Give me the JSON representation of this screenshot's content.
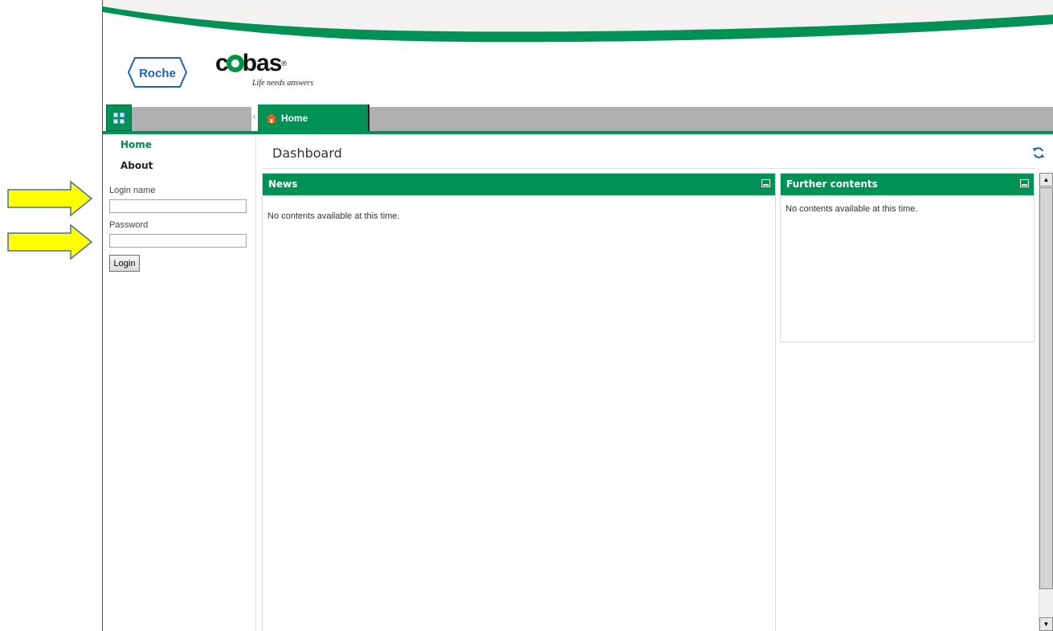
{
  "brand": {
    "roche_logo_text": "Roche",
    "cobas_logo_text": "cobas",
    "registered_mark": "®",
    "tagline": "Life needs answers"
  },
  "tabs": [
    {
      "label": "Home",
      "active": true
    }
  ],
  "sidebar": {
    "nav": [
      {
        "label": "Home"
      },
      {
        "label": "About"
      }
    ],
    "login": {
      "login_name_label": "Login name",
      "login_name_value": "",
      "password_label": "Password",
      "password_value": "",
      "login_button": "Login"
    }
  },
  "dashboard": {
    "title": "Dashboard",
    "panels": [
      {
        "title": "News",
        "body": "No contents available at this time."
      },
      {
        "title": "Further contents",
        "body": "No contents available at this time."
      }
    ]
  },
  "colors": {
    "brand_green": "#009155",
    "tab_gray": "#b0afb1",
    "annotation_arrow": "#ffff00"
  },
  "icons": [
    "menu-grid-icon",
    "home-icon",
    "refresh-icon",
    "minimize-icon",
    "scroll-up-icon",
    "scroll-down-icon",
    "annotation-arrow"
  ]
}
